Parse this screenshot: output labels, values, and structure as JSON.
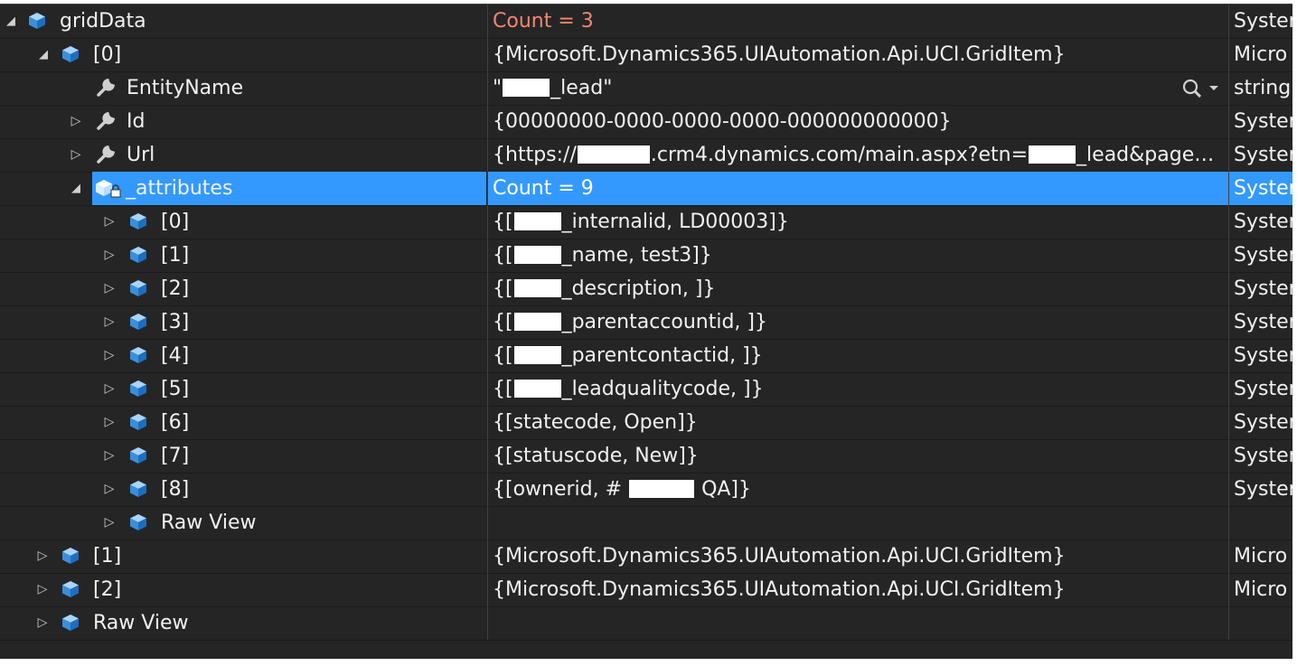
{
  "rows": [
    {
      "name": "gridData",
      "value": "Count = 3",
      "type": "Syster"
    },
    {
      "name": "[0]",
      "value": "{Microsoft.Dynamics365.UIAutomation.Api.UCI.GridItem}",
      "type": "Micro"
    },
    {
      "name": "EntityName",
      "value_prefix": "\"",
      "value_suffix": "_lead\"",
      "type": "string"
    },
    {
      "name": "Id",
      "value": "{00000000-0000-0000-0000-000000000000}",
      "type": "Syster"
    },
    {
      "name": "Url",
      "value_prefix": "{https://",
      "value_mid": ".crm4.dynamics.com/main.aspx?etn=",
      "value_suffix": "_lead&page…",
      "type": "Syster"
    },
    {
      "name": "_attributes",
      "value": "Count = 9",
      "type": "Syster"
    },
    {
      "name": "[0]",
      "value_prefix": "{[",
      "value_suffix": "_internalid, LD00003]}",
      "type": "Syster"
    },
    {
      "name": "[1]",
      "value_prefix": "{[",
      "value_suffix": "_name, test3]}",
      "type": "Syster"
    },
    {
      "name": "[2]",
      "value_prefix": "{[",
      "value_suffix": "_description, ]}",
      "type": "Syster"
    },
    {
      "name": "[3]",
      "value_prefix": "{[",
      "value_suffix": "_parentaccountid, ]}",
      "type": "Syster"
    },
    {
      "name": "[4]",
      "value_prefix": "{[",
      "value_suffix": "_parentcontactid, ]}",
      "type": "Syster"
    },
    {
      "name": "[5]",
      "value_prefix": "{[",
      "value_suffix": "_leadqualitycode, ]}",
      "type": "Syster"
    },
    {
      "name": "[6]",
      "value": "{[statecode, Open]}",
      "type": "Syster"
    },
    {
      "name": "[7]",
      "value": "{[statuscode, New]}",
      "type": "Syster"
    },
    {
      "name": "[8]",
      "value_prefix": "{[ownerid, #",
      "value_suffix": "QA]}",
      "type": "Syster"
    },
    {
      "name": "Raw View",
      "value": "",
      "type": ""
    },
    {
      "name": "[1]",
      "value": "{Microsoft.Dynamics365.UIAutomation.Api.UCI.GridItem}",
      "type": "Micro"
    },
    {
      "name": "[2]",
      "value": "{Microsoft.Dynamics365.UIAutomation.Api.UCI.GridItem}",
      "type": "Micro"
    },
    {
      "name": "Raw View",
      "value": "",
      "type": ""
    }
  ],
  "icons": {
    "object": "cube-icon",
    "property": "wrench-icon",
    "private_field": "locked-field-icon",
    "visualizer": "magnifier-icon"
  },
  "colors": {
    "background": "#252526",
    "selected": "#3399ff",
    "count_text": "#f48771",
    "text": "#f1f1f1"
  }
}
